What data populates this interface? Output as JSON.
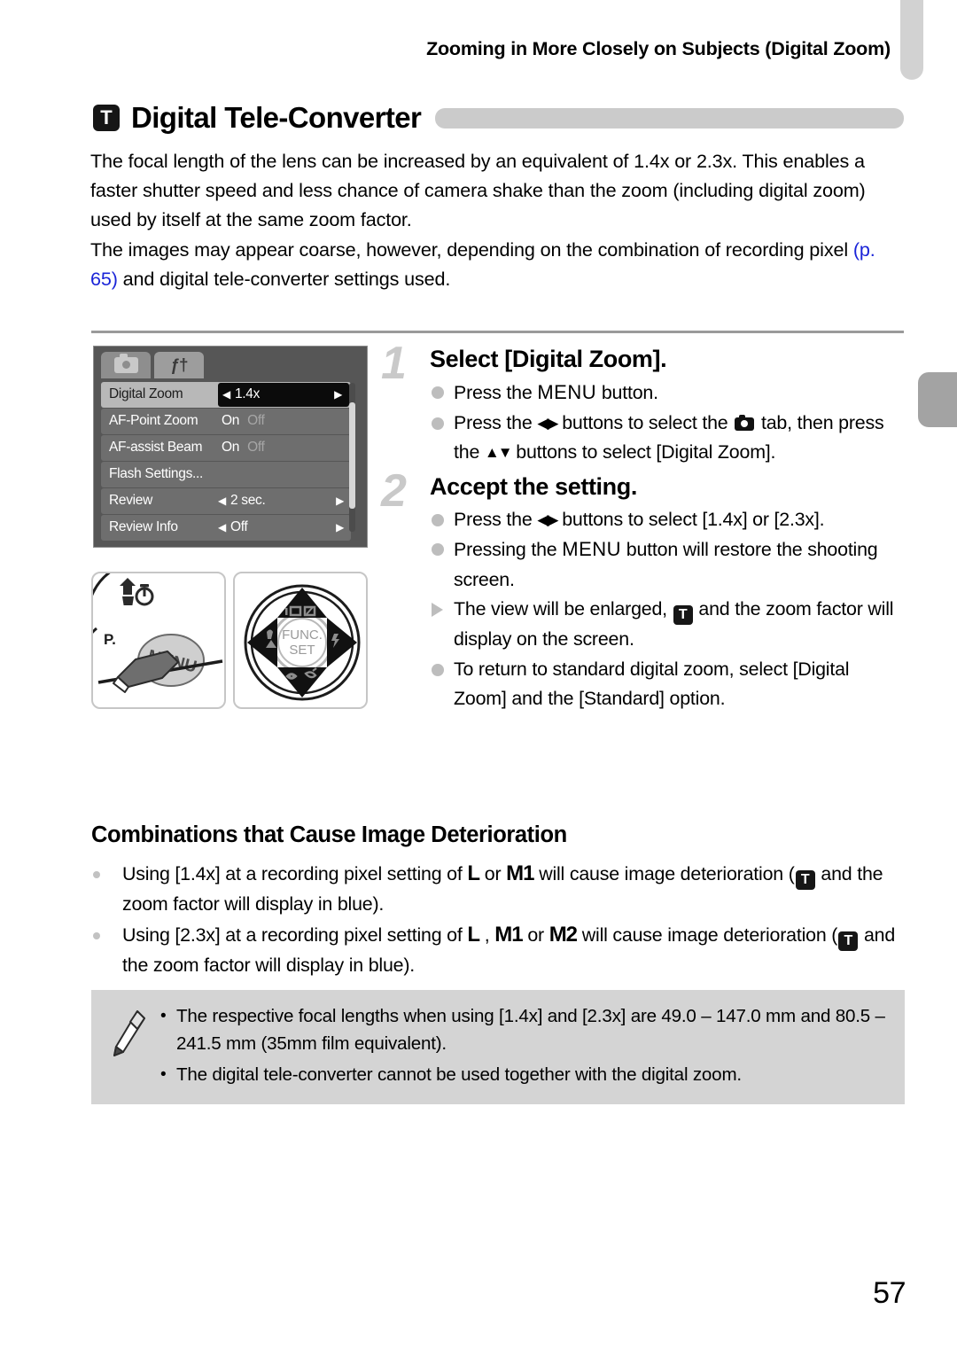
{
  "running_head": "Zooming in More Closely on Subjects (Digital Zoom)",
  "section": {
    "icon": "tele-converter-t-icon",
    "icon_letter": "T",
    "title": "Digital Tele-Converter"
  },
  "intro": {
    "paragraph1": "The focal length of the lens can be increased by an equivalent of 1.4x or 2.3x. This enables a faster shutter speed and less chance of camera shake than the zoom (including digital zoom) used by itself at the same zoom factor.",
    "paragraph2_before": "The images may appear coarse, however, depending on the combination of recording pixel ",
    "paragraph2_xref": "(p. 65)",
    "paragraph2_after": " and digital tele-converter settings used."
  },
  "menu_screenshot": {
    "tabs": [
      {
        "name": "shooting-tab",
        "icon": "camera-icon",
        "active": true
      },
      {
        "name": "settings-tab",
        "icon": "wrench-tools-icon",
        "active": false
      }
    ],
    "rows": [
      {
        "label": "Digital Zoom",
        "value": "1.4x",
        "type": "valuebox",
        "selected": true
      },
      {
        "label": "AF-Point Zoom",
        "on": "On",
        "off": "Off",
        "type": "onoff",
        "selected": false
      },
      {
        "label": "AF-assist Beam",
        "on": "On",
        "off": "Off",
        "type": "onoff",
        "selected": false
      },
      {
        "label": "Flash Settings...",
        "value": "",
        "type": "plain",
        "selected": false
      },
      {
        "label": "Review",
        "value": "2 sec.",
        "type": "arrows",
        "selected": false
      },
      {
        "label": "Review Info",
        "value": "Off",
        "type": "arrows",
        "selected": false
      }
    ]
  },
  "illustrations": [
    {
      "name": "menu-button-press-illustration",
      "label": "MENU"
    },
    {
      "name": "four-way-controller-illustration",
      "label": "FUNC. SET"
    }
  ],
  "steps": [
    {
      "number": "1",
      "heading": "Select [Digital Zoom].",
      "bullets": [
        {
          "marker": "dot",
          "segments": [
            {
              "t": "text",
              "v": "Press the "
            },
            {
              "t": "menu",
              "v": "MENU"
            },
            {
              "t": "text",
              "v": " button."
            }
          ]
        },
        {
          "marker": "dot",
          "segments": [
            {
              "t": "text",
              "v": "Press the "
            },
            {
              "t": "lr",
              "v": "◀▶"
            },
            {
              "t": "text",
              "v": " buttons to select the "
            },
            {
              "t": "cam",
              "v": ""
            },
            {
              "t": "text",
              "v": " tab, then press the "
            },
            {
              "t": "ud",
              "v": "▲▼"
            },
            {
              "t": "text",
              "v": " buttons to select [Digital Zoom]."
            }
          ]
        }
      ]
    },
    {
      "number": "2",
      "heading": "Accept the setting.",
      "bullets": [
        {
          "marker": "dot",
          "segments": [
            {
              "t": "text",
              "v": "Press the "
            },
            {
              "t": "lr",
              "v": "◀▶"
            },
            {
              "t": "text",
              "v": " buttons to select [1.4x] or [2.3x]."
            }
          ]
        },
        {
          "marker": "dot",
          "segments": [
            {
              "t": "text",
              "v": "Pressing the "
            },
            {
              "t": "menu",
              "v": "MENU"
            },
            {
              "t": "text",
              "v": " button will restore the shooting screen."
            }
          ]
        },
        {
          "marker": "triangle",
          "segments": [
            {
              "t": "text",
              "v": "The view will be enlarged, "
            },
            {
              "t": "tbox",
              "v": "T"
            },
            {
              "t": "text",
              "v": " and the zoom factor will display on the screen."
            }
          ]
        },
        {
          "marker": "dot",
          "segments": [
            {
              "t": "text",
              "v": "To return to standard digital zoom, select [Digital Zoom] and the [Standard] option."
            }
          ]
        }
      ]
    }
  ],
  "combinations": {
    "heading": "Combinations that Cause Image Deterioration",
    "items": [
      {
        "segments": [
          {
            "t": "text",
            "v": "Using [1.4x] at a recording pixel setting of "
          },
          {
            "t": "px",
            "v": "L"
          },
          {
            "t": "text",
            "v": " or "
          },
          {
            "t": "px",
            "v": "M1"
          },
          {
            "t": "text",
            "v": " will cause image deterioration ("
          },
          {
            "t": "tbox",
            "v": "T"
          },
          {
            "t": "text",
            "v": " and the zoom factor will display in blue)."
          }
        ]
      },
      {
        "segments": [
          {
            "t": "text",
            "v": "Using [2.3x] at a recording pixel setting of "
          },
          {
            "t": "px",
            "v": "L"
          },
          {
            "t": "text",
            "v": " , "
          },
          {
            "t": "px",
            "v": "M1"
          },
          {
            "t": "text",
            "v": " or "
          },
          {
            "t": "px",
            "v": "M2"
          },
          {
            "t": "text",
            "v": " will cause image deterioration ("
          },
          {
            "t": "tbox",
            "v": "T"
          },
          {
            "t": "text",
            "v": " and the zoom factor will display in blue)."
          }
        ]
      }
    ]
  },
  "note": {
    "icon": "pencil-icon",
    "bullet_char": "•",
    "items": [
      "The respective focal lengths when using [1.4x] and [2.3x] are 49.0 – 147.0 mm and 80.5 – 241.5 mm (35mm film equivalent).",
      "The digital tele-converter cannot be used together with the digital zoom."
    ]
  },
  "page_number": "57",
  "colors": {
    "xref_blue": "#1a24d8",
    "title_bar_gray": "#cbcbcb",
    "note_bg": "#d4d4d4",
    "step_number_gray": "#c9c9c9"
  }
}
